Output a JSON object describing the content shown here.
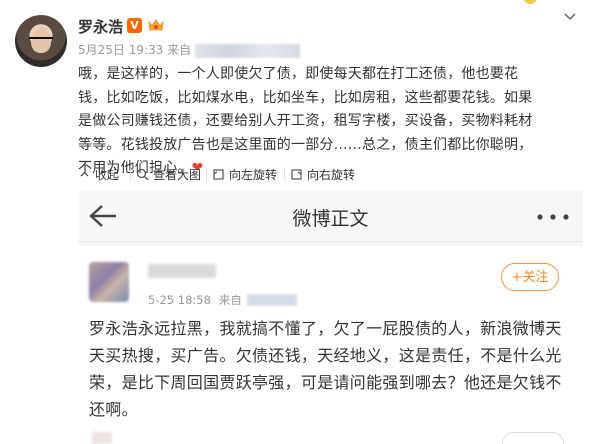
{
  "post": {
    "username": "罗永浩",
    "verified_badge": "V",
    "member_icon": "crown-icon",
    "date": "5月25日 19:33",
    "source_prefix": "来自",
    "content": "哦，是这样的，一个人即使欠了债，即使每天都在打工还债，他也要花钱，比如吃饭，比如煤水电，比如坐车，比如房租，这些都要花钱。如果是做公司赚钱还债，还要给别人开工资，租写字楼，买设备，买物料耗材等等。花钱投放广告也是这里面的一部分……总之，债主们都比你聪明，不用为他们担心。",
    "heart": "❤"
  },
  "image_tools": {
    "collapse": "收起",
    "view_large": "查看大图",
    "rotate_left": "向左旋转",
    "rotate_right": "向右旋转"
  },
  "screenshot": {
    "header_title": "微博正文",
    "more_icon": "more-dots-icon",
    "card": {
      "date": "5-25 18:58",
      "source_prefix": "来自",
      "follow_label": "+关注",
      "text": "罗永浩永远拉黑，我就搞不懂了，欠了一屁股债的人，新浪微博天天买热搜，买广告。欠债还钱，天经地义，这是责任，不是什么光荣，是比下周回国贾跃亭强，可是请问能强到哪去？他还是欠钱不还啊。"
    }
  },
  "colors": {
    "accent_orange": "#f08a2a",
    "vip_orange": "#ff6600",
    "heart_red": "#e0453a",
    "meta_gray": "#999999"
  }
}
